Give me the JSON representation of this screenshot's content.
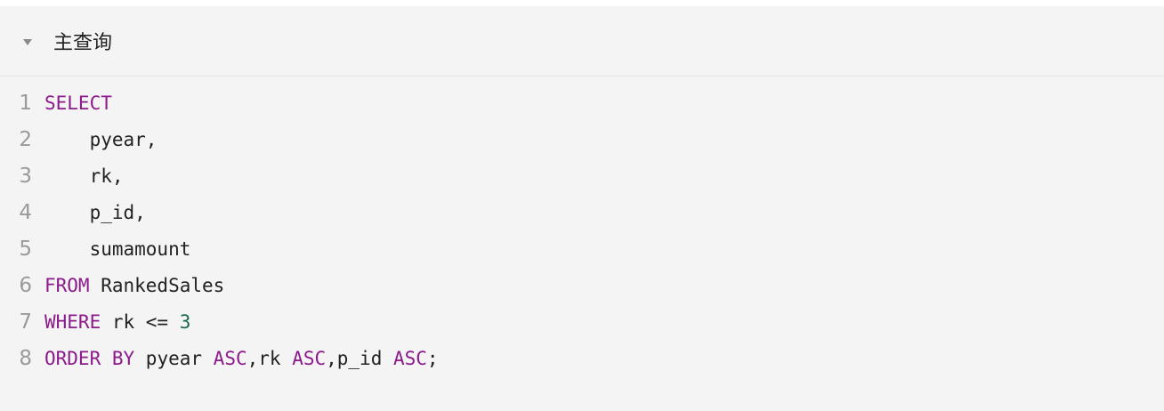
{
  "panel": {
    "title": "主查询",
    "toggle_icon": "caret-down-icon"
  },
  "code": {
    "lines": [
      {
        "no": "1",
        "tokens": [
          {
            "t": "SELECT",
            "k": "kw"
          }
        ]
      },
      {
        "no": "2",
        "tokens": [
          {
            "t": "    pyear,",
            "k": "txt"
          }
        ]
      },
      {
        "no": "3",
        "tokens": [
          {
            "t": "    rk,",
            "k": "txt"
          }
        ]
      },
      {
        "no": "4",
        "tokens": [
          {
            "t": "    p_id,",
            "k": "txt"
          }
        ]
      },
      {
        "no": "5",
        "tokens": [
          {
            "t": "    sumamount",
            "k": "txt"
          }
        ]
      },
      {
        "no": "6",
        "tokens": [
          {
            "t": "FROM",
            "k": "kw"
          },
          {
            "t": " RankedSales",
            "k": "txt"
          }
        ]
      },
      {
        "no": "7",
        "tokens": [
          {
            "t": "WHERE",
            "k": "kw"
          },
          {
            "t": " rk <= ",
            "k": "txt"
          },
          {
            "t": "3",
            "k": "num"
          }
        ]
      },
      {
        "no": "8",
        "tokens": [
          {
            "t": "ORDER BY",
            "k": "kw"
          },
          {
            "t": " pyear ",
            "k": "txt"
          },
          {
            "t": "ASC",
            "k": "kw"
          },
          {
            "t": ",rk ",
            "k": "txt"
          },
          {
            "t": "ASC",
            "k": "kw"
          },
          {
            "t": ",p_id ",
            "k": "txt"
          },
          {
            "t": "ASC",
            "k": "kw"
          },
          {
            "t": ";",
            "k": "txt"
          }
        ]
      }
    ]
  },
  "colors": {
    "keyword": "#8b1a8b",
    "number": "#1b6b4b",
    "text": "#222222",
    "line_number": "#9a9a9a",
    "panel_background": "#f4f4f4"
  }
}
